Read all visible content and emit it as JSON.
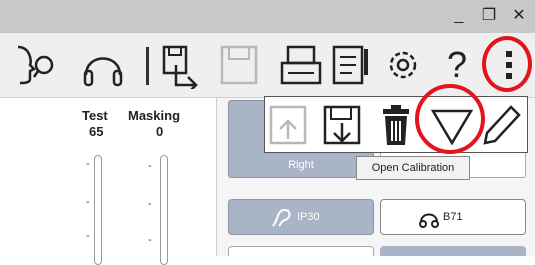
{
  "window": {
    "minimize_glyph": "_",
    "restore_glyph": "❐",
    "close_glyph": "✕"
  },
  "toolbar": {
    "icons": [
      "speaker-face-icon",
      "headphones-icon",
      "import-icon",
      "save-disabled-icon",
      "print-icon",
      "report-icon",
      "gear-icon",
      "help-icon",
      "more-vertical-icon"
    ],
    "help_glyph": "?"
  },
  "levels": {
    "test_label": "Test",
    "test_value": "65",
    "masking_label": "Masking",
    "masking_value": "0",
    "tick_glyph": "-"
  },
  "ear": {
    "right_label": "Right"
  },
  "calibration_popup": {
    "icons": [
      "load-disabled-icon",
      "save-calibration-icon",
      "delete-icon",
      "open-calibration-icon",
      "edit-icon"
    ],
    "tooltip": "Open Calibration"
  },
  "transducers": {
    "ip30_label": "IP30",
    "b71_label": "B71"
  },
  "colors": {
    "accent_selected": "#a9b5c7",
    "highlight_ring": "#e3141b"
  }
}
